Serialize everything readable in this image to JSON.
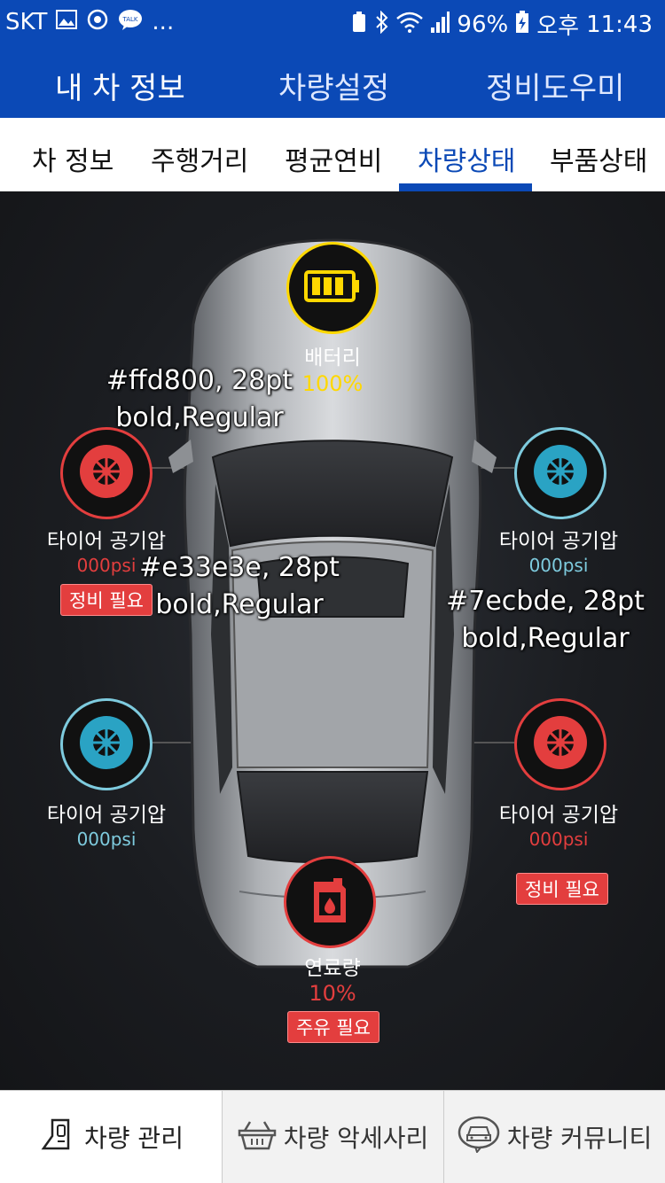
{
  "statusbar": {
    "carrier": "SKT",
    "left_icons": [
      "image-icon",
      "timer-icon",
      "talk-icon"
    ],
    "overflow": "...",
    "battery_percent": "96%",
    "ampm": "오후",
    "time": "11:43"
  },
  "topnav": {
    "items": [
      "내 차 정보",
      "차량설정",
      "정비도우미"
    ]
  },
  "subtabs": {
    "items": [
      "차 정보",
      "주행거리",
      "평균연비",
      "차량상태",
      "부품상태"
    ],
    "active": "차량상태"
  },
  "colors": {
    "primary": "#0b49b6",
    "yellow": "#ffd800",
    "red": "#e33e3e",
    "blue": "#7ecbde"
  },
  "battery": {
    "label": "배터리",
    "value": "100%"
  },
  "tires": {
    "front_left": {
      "label": "타이어 공기압",
      "value": "000psi",
      "badge": "정비 필요"
    },
    "front_right": {
      "label": "타이어 공기압",
      "value": "000psi"
    },
    "rear_left": {
      "label": "타이어 공기압",
      "value": "000psi"
    },
    "rear_right": {
      "label": "타이어 공기압",
      "value": "000psi",
      "badge": "정비 필요"
    }
  },
  "fuel": {
    "label": "연료량",
    "value": "10%",
    "badge": "주유 필요"
  },
  "notes": {
    "yellow": [
      "#ffd800, 28pt",
      "bold,Regular"
    ],
    "red": [
      "#e33e3e, 28pt",
      "bold,Regular"
    ],
    "blue": [
      "#7ecbde, 28pt",
      "bold,Regular"
    ]
  },
  "bottomnav": {
    "items": [
      "차량 관리",
      "차량 악세사리",
      "차량 커뮤니티"
    ]
  }
}
